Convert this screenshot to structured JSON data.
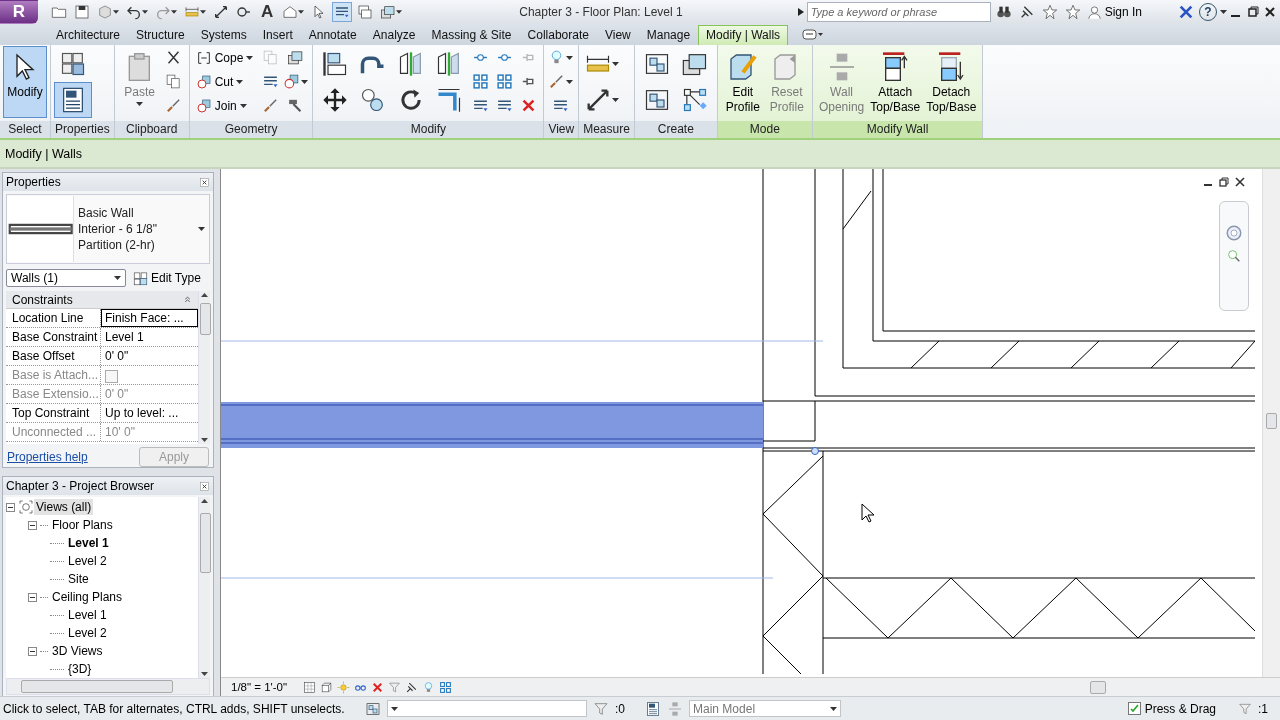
{
  "title_bar": {
    "app_menu": "R",
    "text_tool": "A",
    "title": "Chapter 3 - Floor Plan: Level 1",
    "search": {
      "placeholder": "Type a keyword or phrase"
    },
    "sign_in": "Sign In",
    "help": "?"
  },
  "tabs": [
    {
      "label": "Architecture",
      "selected": false,
      "contextual": false
    },
    {
      "label": "Structure",
      "selected": false,
      "contextual": false
    },
    {
      "label": "Systems",
      "selected": false,
      "contextual": false
    },
    {
      "label": "Insert",
      "selected": false,
      "contextual": false
    },
    {
      "label": "Annotate",
      "selected": false,
      "contextual": false
    },
    {
      "label": "Analyze",
      "selected": false,
      "contextual": false
    },
    {
      "label": "Massing & Site",
      "selected": false,
      "contextual": false
    },
    {
      "label": "Collaborate",
      "selected": false,
      "contextual": false
    },
    {
      "label": "View",
      "selected": false,
      "contextual": false
    },
    {
      "label": "Manage",
      "selected": false,
      "contextual": false
    },
    {
      "label": "Modify | Walls",
      "selected": true,
      "contextual": true
    }
  ],
  "ribbon": {
    "panels": [
      {
        "title": "Select",
        "contextual": false,
        "tools": [
          {
            "kind": "large",
            "label": "Modify",
            "selected": true,
            "disabled": false,
            "dropdown": false
          }
        ]
      },
      {
        "title": "Properties",
        "contextual": false,
        "tools": [
          {
            "kind": "medium",
            "selected": false,
            "disabled": false,
            "dropdown": false
          },
          {
            "kind": "medium",
            "selected": true,
            "disabled": false,
            "dropdown": false
          }
        ]
      },
      {
        "title": "Clipboard",
        "contextual": false,
        "tools": [
          {
            "kind": "large",
            "label": "Paste",
            "selected": false,
            "disabled": true,
            "dropdown": true
          },
          {
            "kind": "icon",
            "selected": false,
            "disabled": false,
            "dropdown": false
          },
          {
            "kind": "icon",
            "selected": false,
            "disabled": false,
            "dropdown": false
          },
          {
            "kind": "icon",
            "selected": false,
            "disabled": false,
            "dropdown": false
          }
        ]
      },
      {
        "title": "Geometry",
        "contextual": false,
        "tools": [
          {
            "kind": "row",
            "label": "Cope",
            "selected": false,
            "disabled": false,
            "dropdown": true
          },
          {
            "kind": "row",
            "label": "Cut",
            "selected": false,
            "disabled": false,
            "dropdown": true
          },
          {
            "kind": "row",
            "label": "Join",
            "selected": false,
            "disabled": false,
            "dropdown": true
          },
          {
            "kind": "icon",
            "selected": false,
            "disabled": true,
            "dropdown": false
          },
          {
            "kind": "icon",
            "selected": false,
            "disabled": false,
            "dropdown": false
          },
          {
            "kind": "icon",
            "selected": false,
            "disabled": false,
            "dropdown": false
          },
          {
            "kind": "icon",
            "selected": false,
            "disabled": false,
            "dropdown": false
          },
          {
            "kind": "icon",
            "selected": false,
            "disabled": false,
            "dropdown": true
          },
          {
            "kind": "icon",
            "selected": false,
            "disabled": false,
            "dropdown": false
          }
        ]
      },
      {
        "title": "Modify",
        "contextual": false,
        "tools": [
          {
            "kind": "medium",
            "selected": false,
            "disabled": false,
            "dropdown": false
          },
          {
            "kind": "medium",
            "selected": false,
            "disabled": false,
            "dropdown": false
          },
          {
            "kind": "medium",
            "selected": false,
            "disabled": false,
            "dropdown": false
          },
          {
            "kind": "medium",
            "selected": false,
            "disabled": false,
            "dropdown": false
          },
          {
            "kind": "medium",
            "selected": false,
            "disabled": false,
            "dropdown": false
          },
          {
            "kind": "medium",
            "selected": false,
            "disabled": false,
            "dropdown": false
          },
          {
            "kind": "medium",
            "selected": false,
            "disabled": false,
            "dropdown": false
          },
          {
            "kind": "medium",
            "selected": false,
            "disabled": false,
            "dropdown": false
          },
          {
            "kind": "icon",
            "selected": false,
            "disabled": false,
            "dropdown": false
          },
          {
            "kind": "icon",
            "selected": false,
            "disabled": false,
            "dropdown": false
          },
          {
            "kind": "icon",
            "selected": false,
            "disabled": false,
            "dropdown": false
          },
          {
            "kind": "icon",
            "selected": false,
            "disabled": false,
            "dropdown": false
          },
          {
            "kind": "icon",
            "selected": false,
            "disabled": false,
            "dropdown": false
          },
          {
            "kind": "icon",
            "selected": false,
            "disabled": false,
            "dropdown": false
          },
          {
            "kind": "icon",
            "selected": false,
            "disabled": true,
            "dropdown": false
          },
          {
            "kind": "icon",
            "selected": false,
            "disabled": false,
            "dropdown": false
          },
          {
            "kind": "icon",
            "selected": false,
            "disabled": false,
            "dropdown": false
          }
        ]
      },
      {
        "title": "View",
        "contextual": false,
        "tools": [
          {
            "kind": "icon",
            "selected": false,
            "disabled": false,
            "dropdown": true
          },
          {
            "kind": "icon",
            "selected": false,
            "disabled": false,
            "dropdown": true
          },
          {
            "kind": "icon",
            "selected": false,
            "disabled": false,
            "dropdown": false
          }
        ]
      },
      {
        "title": "Measure",
        "contextual": false,
        "tools": [
          {
            "kind": "medium",
            "selected": false,
            "disabled": false,
            "dropdown": true
          },
          {
            "kind": "medium",
            "selected": false,
            "disabled": false,
            "dropdown": true
          }
        ]
      },
      {
        "title": "Create",
        "contextual": false,
        "tools": [
          {
            "kind": "medium",
            "selected": false,
            "disabled": false,
            "dropdown": false
          },
          {
            "kind": "medium",
            "selected": false,
            "disabled": false,
            "dropdown": false
          },
          {
            "kind": "medium",
            "selected": false,
            "disabled": false,
            "dropdown": false
          },
          {
            "kind": "medium",
            "selected": false,
            "disabled": false,
            "dropdown": false
          }
        ]
      },
      {
        "title": "Mode",
        "contextual": true,
        "tools": [
          {
            "kind": "large",
            "label": "Edit Profile",
            "selected": false,
            "disabled": false,
            "dropdown": false
          },
          {
            "kind": "large",
            "label": "Reset Profile",
            "selected": false,
            "disabled": true,
            "dropdown": false
          }
        ]
      },
      {
        "title": "Modify Wall",
        "contextual": true,
        "tools": [
          {
            "kind": "large",
            "label": "Wall Opening",
            "selected": false,
            "disabled": true,
            "dropdown": false
          },
          {
            "kind": "large",
            "label": "Attach Top/Base",
            "selected": false,
            "disabled": false,
            "dropdown": false
          },
          {
            "kind": "large",
            "label": "Detach Top/Base",
            "selected": false,
            "disabled": false,
            "dropdown": false
          }
        ]
      }
    ]
  },
  "options_bar": {
    "label": "Modify | Walls"
  },
  "properties": {
    "title": "Properties",
    "type_lines": [
      "Basic Wall",
      "Interior - 6 1/8\"",
      "Partition (2-hr)"
    ],
    "filter": "Walls (1)",
    "edit_type": "Edit Type",
    "group": "Constraints",
    "rows": [
      {
        "kind": "text",
        "name": "Location Line",
        "value": "Finish Face: ...",
        "disabled": false,
        "selected": true
      },
      {
        "kind": "text",
        "name": "Base Constraint",
        "value": "Level 1",
        "disabled": false,
        "selected": false
      },
      {
        "kind": "text",
        "name": "Base Offset",
        "value": "0'  0\"",
        "disabled": false,
        "selected": false
      },
      {
        "kind": "checkbox",
        "name": "Base is Attach...",
        "checked": false,
        "disabled": true,
        "selected": false
      },
      {
        "kind": "text",
        "name": "Base Extensio...",
        "value": "0'  0\"",
        "disabled": true,
        "selected": false
      },
      {
        "kind": "text",
        "name": "Top Constraint",
        "value": "Up to level: ...",
        "disabled": false,
        "selected": false
      },
      {
        "kind": "text",
        "name": "Unconnected ...",
        "value": "10'  0\"",
        "disabled": true,
        "selected": false
      }
    ],
    "help": "Properties help",
    "apply": {
      "label": "Apply",
      "disabled": true
    }
  },
  "project_browser": {
    "title": "Chapter 3 - Project Browser",
    "tree": [
      {
        "label": "Views (all)",
        "selected": true,
        "current": false,
        "expanded": true,
        "children": [
          {
            "label": "Floor Plans",
            "selected": false,
            "current": false,
            "expanded": true,
            "children": [
              {
                "label": "Level 1",
                "selected": false,
                "current": true
              },
              {
                "label": "Level 2",
                "selected": false,
                "current": false
              },
              {
                "label": "Site",
                "selected": false,
                "current": false
              }
            ]
          },
          {
            "label": "Ceiling Plans",
            "selected": false,
            "current": false,
            "expanded": true,
            "children": [
              {
                "label": "Level 1",
                "selected": false,
                "current": false
              },
              {
                "label": "Level 2",
                "selected": false,
                "current": false
              }
            ]
          },
          {
            "label": "3D Views",
            "selected": false,
            "current": false,
            "expanded": true,
            "children": [
              {
                "label": "{3D}",
                "selected": false,
                "current": false
              }
            ]
          }
        ]
      }
    ]
  },
  "view": {
    "scale": "1/8\" = 1'-0\""
  },
  "status_bar": {
    "message": "Click to select, TAB for alternates, CTRL adds, SHIFT unselects.",
    "selection_filter": ":0",
    "model": "Main Model",
    "press_drag": {
      "label": "Press & Drag",
      "checked": true
    },
    "filter_count": ":1"
  }
}
